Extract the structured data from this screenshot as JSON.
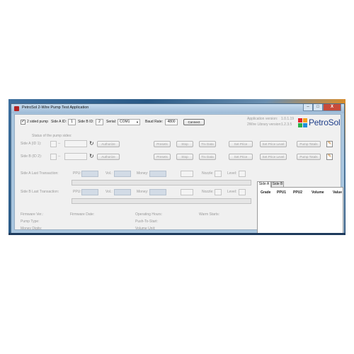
{
  "window": {
    "title": "PetroSol 2-Wire Pump Test Application",
    "controls": [
      "–",
      "□",
      "X"
    ]
  },
  "config": {
    "two_sided_label": "2 sided pump",
    "two_sided_checked": "✓",
    "side_a_id_label": "Side A ID:",
    "side_a_id_value": "1",
    "side_b_id_label": "Side B ID:",
    "side_b_id_value": "2",
    "serial_label": "Serial:",
    "serial_value": "COM1",
    "baud_label": "Baud Rate:",
    "baud_value": "4800",
    "connect_label": "Connect"
  },
  "versions": {
    "app_label": "Application version:",
    "app_value": "1.0.1.19",
    "lib_label": "2Wire Library version:",
    "lib_value": "1.2.3.5"
  },
  "logo": {
    "text": "PetroSol"
  },
  "pump_status_label": "Status of the pump sides:",
  "sides": [
    {
      "label": "Side A (ID 1):",
      "nozzle_dash": "--",
      "authorize": "Authorize"
    },
    {
      "label": "Side B (ID 2):",
      "nozzle_dash": "--",
      "authorize": "Authorize"
    }
  ],
  "side_buttons": [
    "Presets",
    "Stop",
    "Trx Data",
    "Set Price",
    "Set Price Level",
    "Pump Totals"
  ],
  "transactions": [
    {
      "label": "Side A Last Transaction:",
      "ppu": "PPU:",
      "vol": "Vol.:",
      "money": "Money:",
      "nozzle": "Nozzle:",
      "level": "Level:"
    },
    {
      "label": "Side B Last Transaction:",
      "ppu": "PPU:",
      "vol": "Vol.:",
      "money": "Money:",
      "nozzle": "Nozzle:",
      "level": "Level:"
    }
  ],
  "info": {
    "firmware_ver": "Firmware Ver.:",
    "firmware_date": "Firmware Date:",
    "operating_hours": "Operating Hours:",
    "warm_starts": "Warm Starts:",
    "pump_type": "Pump Type:",
    "push_to_start": "Push-To-Start:",
    "money_digits": "Money Digits:",
    "volume_unit": "Volume Unit:"
  },
  "tabs": [
    "Side A",
    "Side B"
  ],
  "grid_headers": [
    "Grade",
    "PPU1",
    "PPU2",
    "Volume",
    "Value"
  ],
  "colors": {
    "logo_blue": "#1f3f8a",
    "close_red": "#c84b3a"
  }
}
